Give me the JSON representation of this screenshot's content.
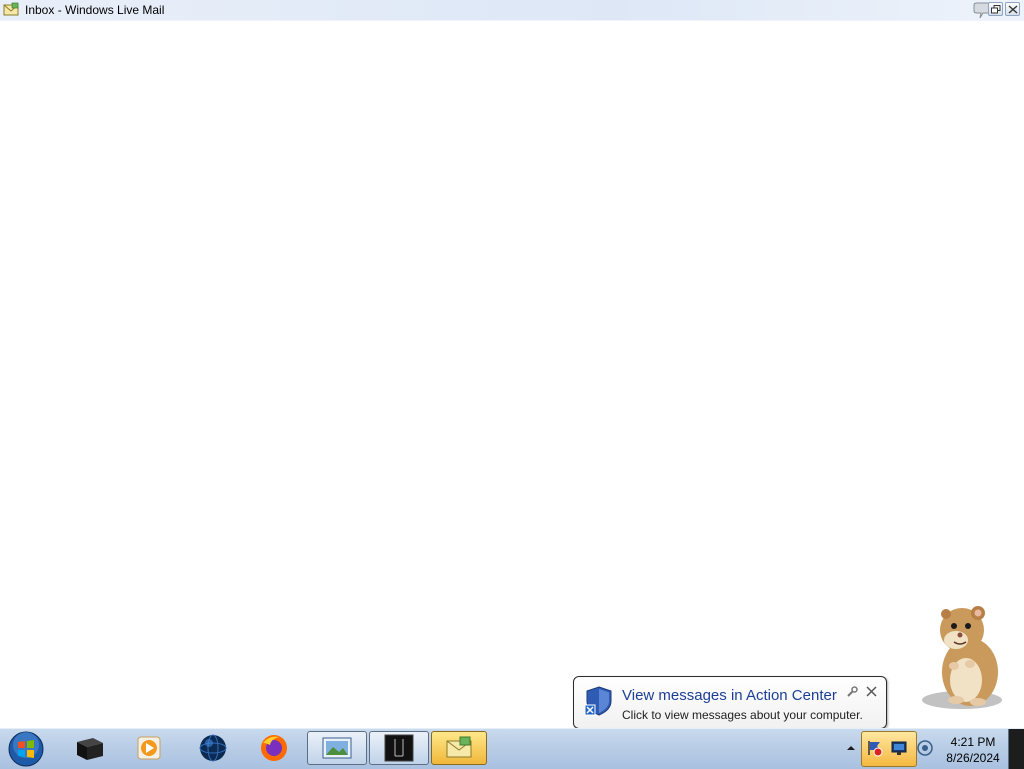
{
  "window": {
    "title": "Inbox - Windows Live Mail"
  },
  "notification": {
    "title": "View messages in Action Center",
    "text": "Click to view messages about your computer.",
    "icon": "action-center-shield-icon"
  },
  "taskbar": {
    "start_icon": "windows-start-orb-icon",
    "pinned": [
      {
        "name": "taskbar-item-dark-app",
        "icon": "black-box-icon"
      },
      {
        "name": "taskbar-item-media-player",
        "icon": "media-player-icon"
      },
      {
        "name": "taskbar-item-globe",
        "icon": "globe-icon"
      },
      {
        "name": "taskbar-item-firefox",
        "icon": "firefox-icon"
      },
      {
        "name": "taskbar-item-photo-viewer",
        "icon": "photo-viewer-icon"
      },
      {
        "name": "taskbar-item-terminal",
        "icon": "terminal-icon"
      },
      {
        "name": "taskbar-item-windows-live-mail",
        "icon": "mail-icon"
      }
    ],
    "clock": {
      "time": "4:21 PM",
      "date": "8/26/2024"
    }
  },
  "colors": {
    "taskbar": "#b8cde6",
    "balloon_title": "#1c3f95",
    "active_button": "#f0b73a"
  }
}
